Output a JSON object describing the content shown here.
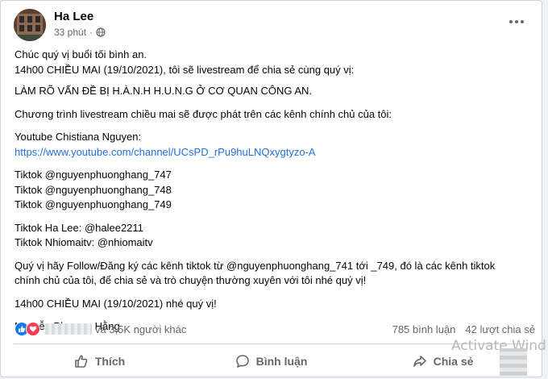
{
  "post": {
    "author": "Ha Lee",
    "time": "33 phút",
    "privacy_icon": "globe-icon",
    "lines": {
      "l1": "Chúc quý vị buổi tối bình an.",
      "l2": "14h00 CHIỀU MAI (19/10/2021), tôi sẽ livestream để chia sẻ cùng quý vị:",
      "l3": "LÀM RÕ VẤN ĐỀ BỊ H.À.N.H H.U.N.G Ở CƠ QUAN CÔNG AN.",
      "l4": "Chương trình livestream chiều mai sẽ được phát trên các kênh chính chủ của tôi:",
      "l5": "Youtube Chistiana Nguyen:",
      "l6": "https://www.youtube.com/channel/UCsPD_rPu9huLNQxygtyzo-A",
      "l7": "Tiktok @nguyenphuonghang_747",
      "l8": "Tiktok @nguyenphuonghang_748",
      "l9": "Tiktok @nguyenphuonghang_749",
      "l10": "Tiktok Ha Lee: @halee2211",
      "l11": "Tiktok Nhiomaitv: @nhiomaitv",
      "l12": "Quý vị hãy Follow/Đăng ký các kênh tiktok từ @nguyenphuonghang_741 tới _749, đó là các kênh tiktok",
      "l13": "chính chủ của tôi, để chia sẻ và trò chuyện thường xuyên với tôi nhé quý vị!",
      "l14": "14h00 CHIỀU MAI (19/10/2021) nhé quý vị!",
      "l15": "Nguyễn Phương Hằng"
    }
  },
  "reactions": {
    "others_text": "và 3,5K người khác",
    "comments": "785 bình luận",
    "shares": "42 lượt chia sẻ"
  },
  "actions": {
    "like": "Thích",
    "comment": "Bình luận",
    "share": "Chia sẻ"
  },
  "watermark": "Activate Wind",
  "colors": {
    "link": "#216fdb",
    "like_blue": "#1877f2",
    "love_red": "#f33e58",
    "muted": "#65676b"
  }
}
